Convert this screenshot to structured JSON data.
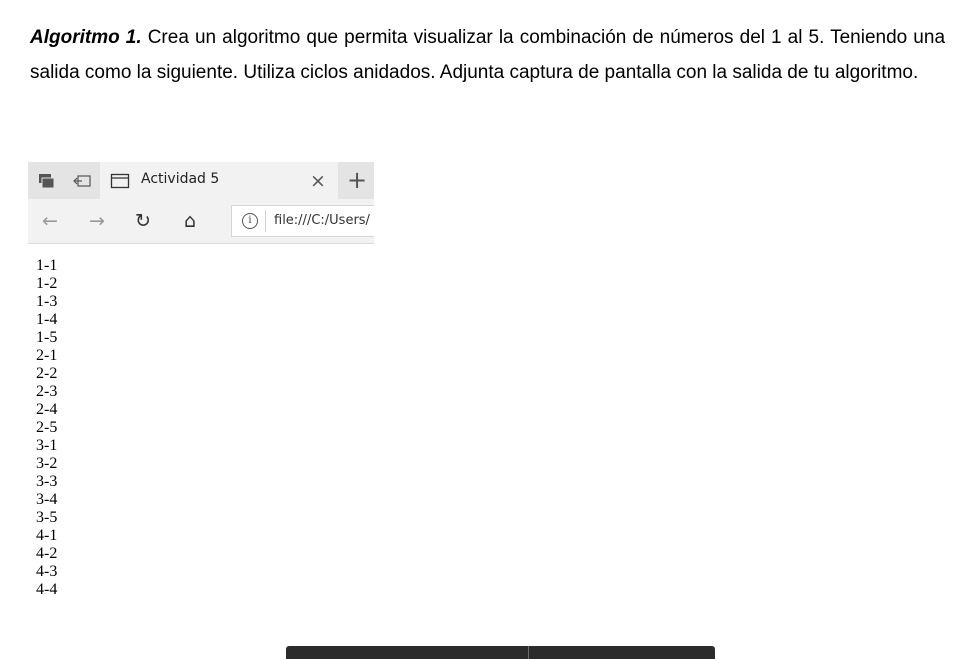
{
  "instructions": {
    "lead": "Algoritmo 1.",
    "body": " Crea un algoritmo que permita visualizar la combinación de números del 1 al 5. Teniendo una salida como la siguiente. Utiliza ciclos anidados. Adjunta captura de pantalla con la salida de tu algoritmo."
  },
  "browser": {
    "tab": {
      "title": "Actividad 5",
      "close": "×"
    },
    "new_tab": "+",
    "nav": {
      "back": "←",
      "forward": "→",
      "refresh": "↻",
      "home": "⌂",
      "info": "i"
    },
    "address": "file:///C:/Users/",
    "output": [
      "1-1",
      "1-2",
      "1-3",
      "1-4",
      "1-5",
      "2-1",
      "2-2",
      "2-3",
      "2-4",
      "2-5",
      "3-1",
      "3-2",
      "3-3",
      "3-4",
      "3-5",
      "4-1",
      "4-2",
      "4-3",
      "4-4"
    ]
  },
  "icons": {
    "tab_manager": "tab-stack-icon",
    "tabs_aside": "tabs-aside-icon",
    "tab_page": "window-icon"
  }
}
